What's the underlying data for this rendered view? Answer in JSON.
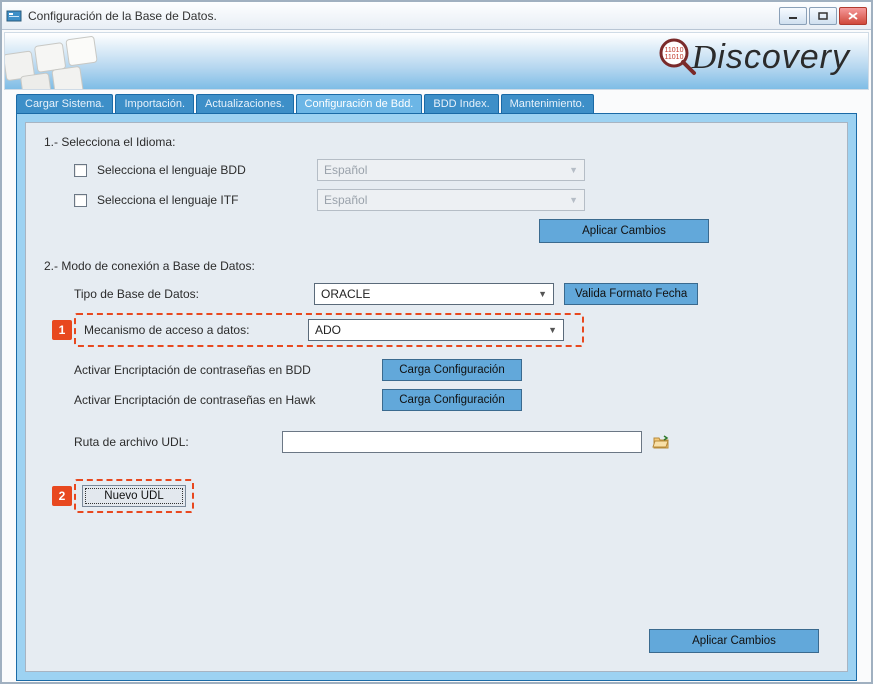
{
  "window": {
    "title": "Configuración de la Base de Datos."
  },
  "logo": {
    "text": "iscovery"
  },
  "tabs": [
    {
      "label": "Cargar Sistema."
    },
    {
      "label": "Importación."
    },
    {
      "label": "Actualizaciones."
    },
    {
      "label": "Configuración de Bdd."
    },
    {
      "label": "BDD Index."
    },
    {
      "label": "Mantenimiento."
    }
  ],
  "section1": {
    "title": "1.- Selecciona el Idioma:",
    "lang_bdd_label": "Selecciona el lenguaje BDD",
    "lang_itf_label": "Selecciona el lenguaje ITF",
    "lang_value": "Español",
    "apply": "Aplicar Cambios"
  },
  "section2": {
    "title": "2.- Modo de conexión a Base de Datos:",
    "db_type_label": "Tipo de Base de Datos:",
    "db_type_value": "ORACLE",
    "valida_fecha": "Valida Formato Fecha",
    "mech_label": "Mecanismo de acceso a datos:",
    "mech_value": "ADO",
    "encrypt_bdd_label": "Activar Encriptación de contraseñas en BDD",
    "encrypt_hawk_label": "Activar Encriptación de contraseñas en Hawk",
    "carga_config": "Carga Configuración",
    "udl_path_label": "Ruta de archivo UDL:",
    "nuevo_udl": "Nuevo UDL",
    "apply": "Aplicar Cambios"
  },
  "callouts": {
    "n1": "1",
    "n2": "2"
  }
}
